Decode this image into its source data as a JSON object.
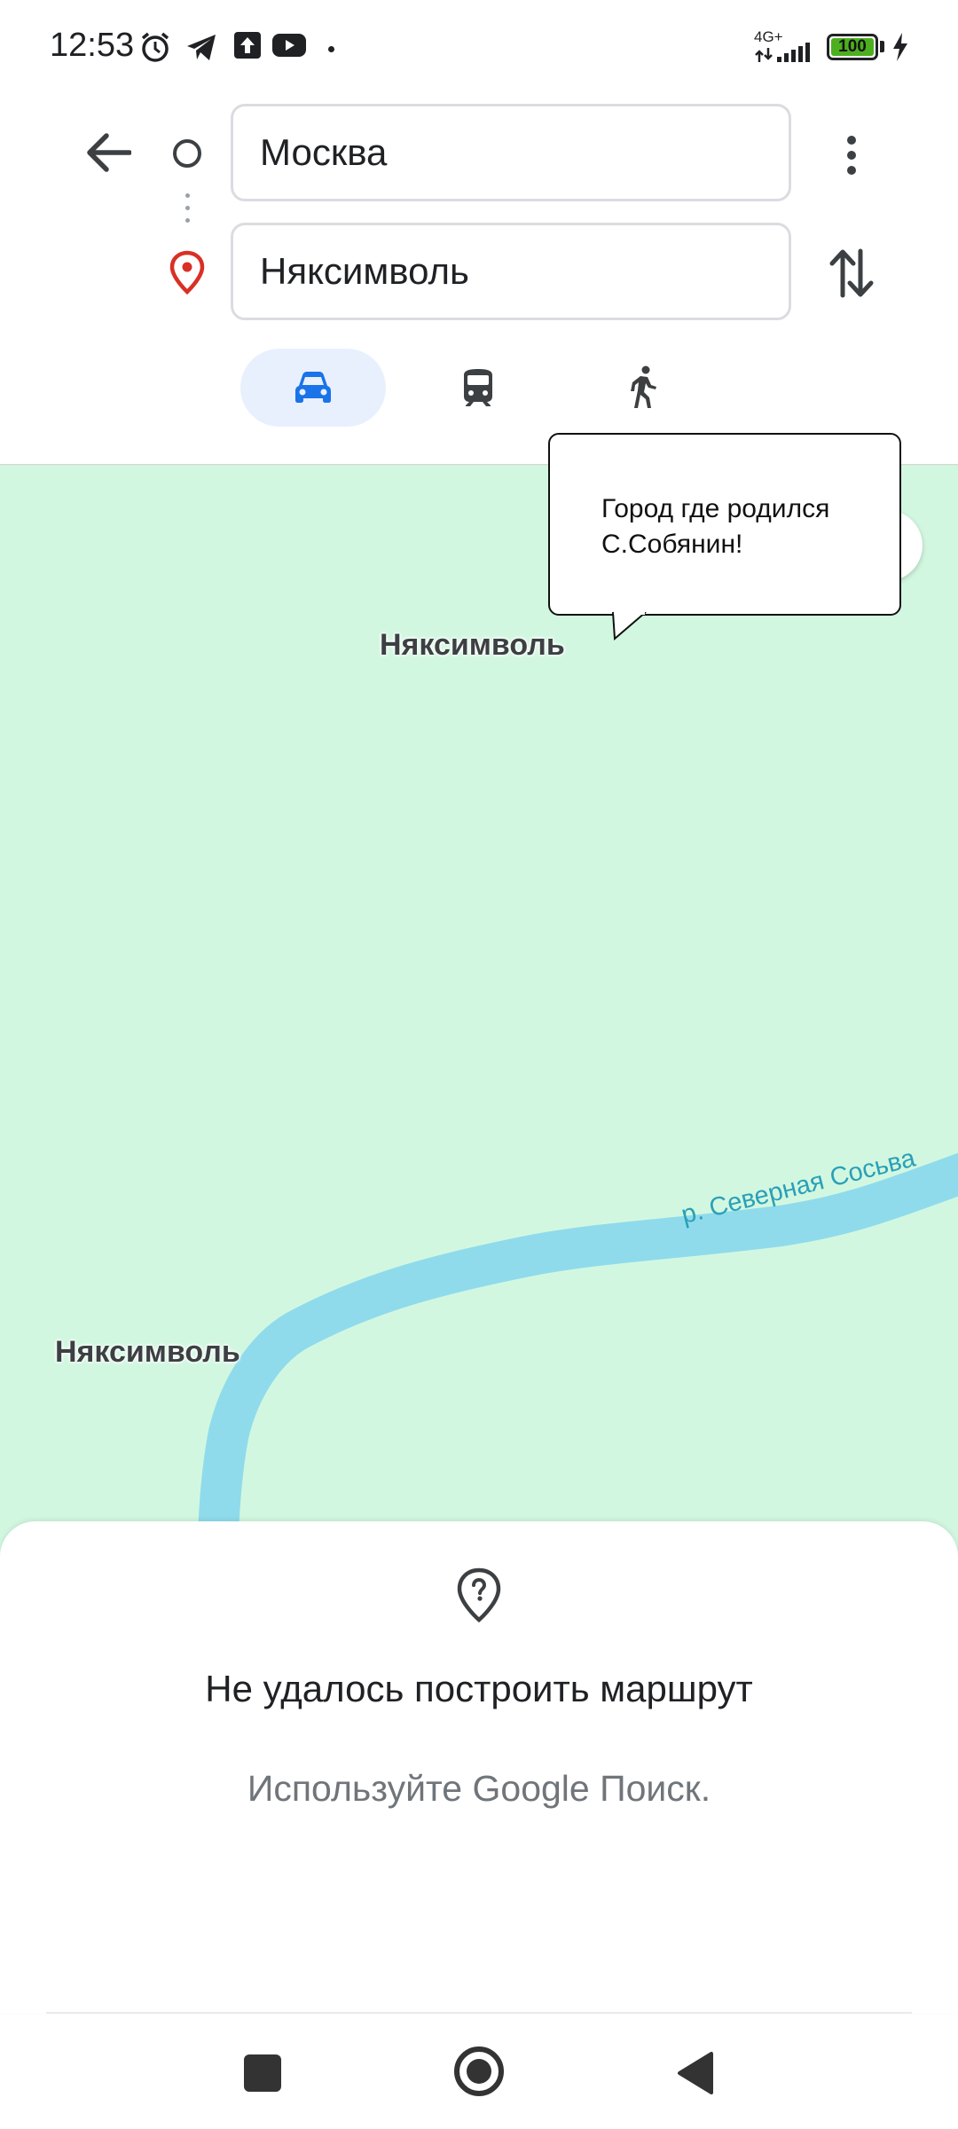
{
  "status_bar": {
    "time": "12:53",
    "network": "4G+",
    "battery": "100",
    "icons": [
      "alarm-icon",
      "telegram-icon",
      "upload-icon",
      "youtube-icon",
      "signal-icon",
      "charging-icon"
    ]
  },
  "directions": {
    "origin": "Москва",
    "destination": "Няксимволь",
    "modes": [
      "driving",
      "transit",
      "walking"
    ],
    "selected_mode": "driving"
  },
  "map": {
    "place_labels": [
      "Няксимволь",
      "Няксимволь"
    ],
    "river_label": "р. Северная Сосьва",
    "callout": {
      "line1": "Город где родился",
      "line2": "С.Собянин!"
    },
    "colors": {
      "land": "#d2f7e0",
      "river": "#8fdbec",
      "accent": "#1a73e8",
      "pin": "#d93025"
    }
  },
  "sheet": {
    "title": "Не удалось построить маршрут",
    "subtitle": "Используйте Google Поиск."
  }
}
